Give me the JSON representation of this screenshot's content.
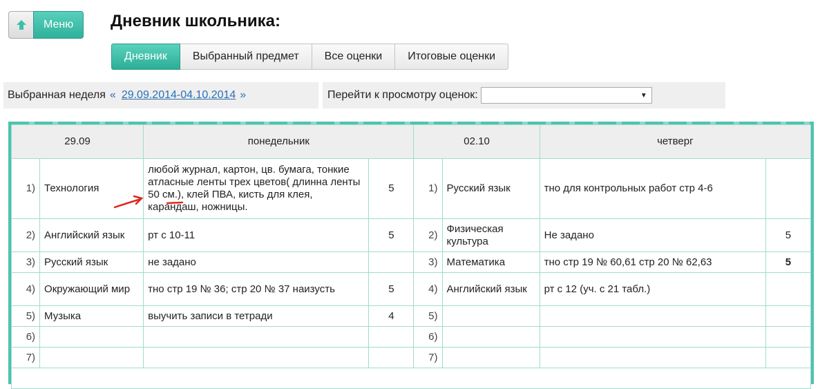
{
  "header": {
    "menu_label": "Меню",
    "title": "Дневник школьника:"
  },
  "tabs": [
    {
      "label": "Дневник",
      "active": true
    },
    {
      "label": "Выбранный предмет",
      "active": false
    },
    {
      "label": "Все оценки",
      "active": false
    },
    {
      "label": "Итоговые оценки",
      "active": false
    }
  ],
  "week": {
    "label": "Выбранная неделя",
    "prev": "«",
    "range": "29.09.2014-04.10.2014",
    "next": "»"
  },
  "goto": {
    "label": "Перейти к просмотру оценок:",
    "selected": ""
  },
  "days": {
    "left": {
      "date": "29.09",
      "weekday": "понедельник",
      "lessons": [
        {
          "num": "1)",
          "subject": "Технология",
          "homework": "любой журнал, картон, цв. бумага, тонкие атласные ленты трех цветов( длинна ленты 50 см.), клей ПВА, кисть для клея, карандаш, ножницы.",
          "grade": "5"
        },
        {
          "num": "2)",
          "subject": "Английский язык",
          "homework": "рт с 10-11",
          "grade": "5"
        },
        {
          "num": "3)",
          "subject": "Русский язык",
          "homework": "не задано",
          "grade": ""
        },
        {
          "num": "4)",
          "subject": "Окружающий мир",
          "homework": "тно стр 19 № 36; стр 20 № 37 наизусть",
          "grade": "5"
        },
        {
          "num": "5)",
          "subject": "Музыка",
          "homework": "выучить записи в тетради",
          "grade": "4"
        },
        {
          "num": "6)",
          "subject": "",
          "homework": "",
          "grade": ""
        },
        {
          "num": "7)",
          "subject": "",
          "homework": "",
          "grade": ""
        }
      ]
    },
    "right": {
      "date": "02.10",
      "weekday": "четверг",
      "lessons": [
        {
          "num": "1)",
          "subject": "Русский язык",
          "homework": "тно для контрольных работ стр 4-6",
          "grade": ""
        },
        {
          "num": "2)",
          "subject": "Физическая культура",
          "homework": "Не задано",
          "grade": "5"
        },
        {
          "num": "3)",
          "subject": "Математика",
          "homework": "тно стр 19 № 60,61 стр 20 № 62,63",
          "grade": "5"
        },
        {
          "num": "4)",
          "subject": "Английский язык",
          "homework": "рт с 12 (уч. с 21 табл.)",
          "grade": ""
        },
        {
          "num": "5)",
          "subject": "",
          "homework": "",
          "grade": ""
        },
        {
          "num": "6)",
          "subject": "",
          "homework": "",
          "grade": ""
        },
        {
          "num": "7)",
          "subject": "",
          "homework": "",
          "grade": ""
        }
      ]
    }
  },
  "colors": {
    "accent": "#2fb19b",
    "link": "#2a6fb5",
    "grid": "#9fdccf",
    "annotation": "#e0261b"
  }
}
